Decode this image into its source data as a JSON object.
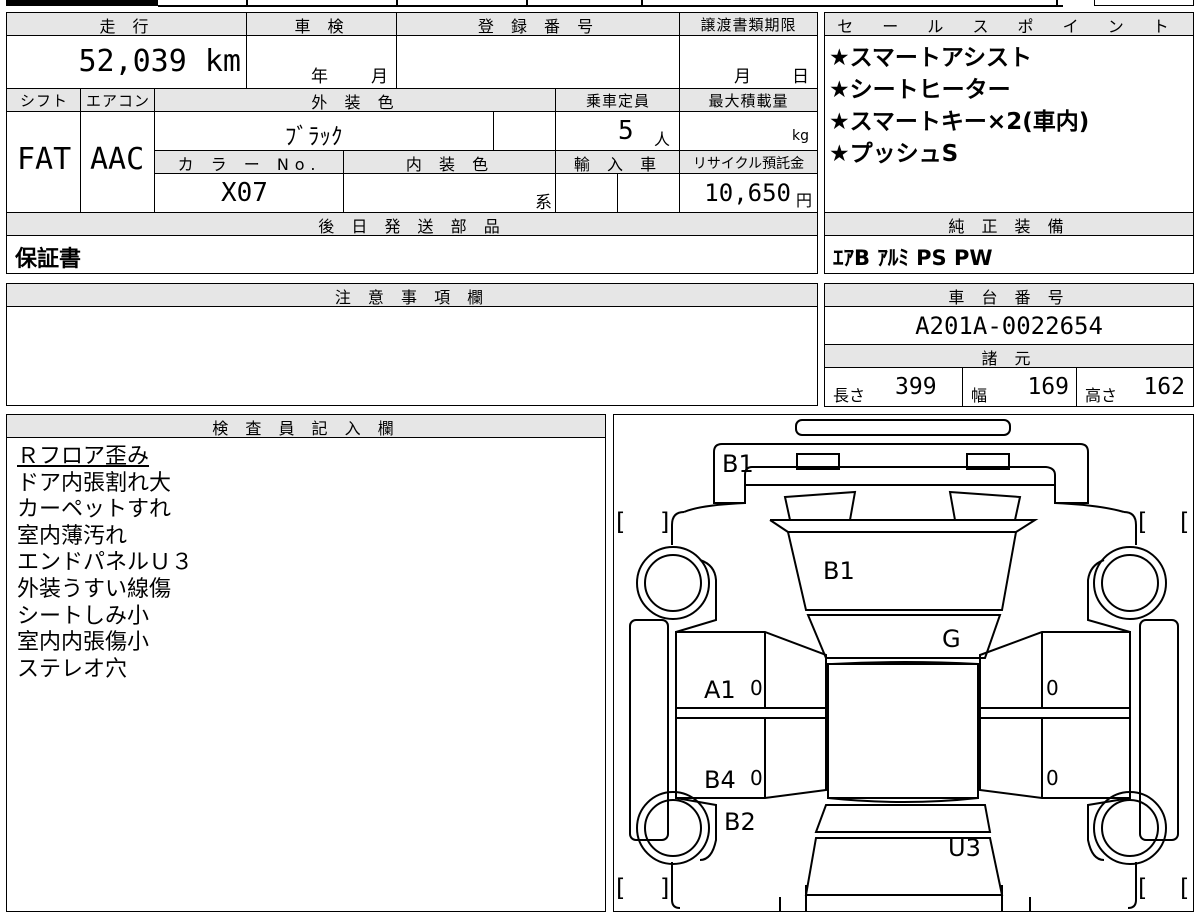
{
  "mileage": {
    "header": "走 行",
    "value": "52,039 km"
  },
  "inspection": {
    "header": "車 検",
    "year_label": "年",
    "month_label": "月"
  },
  "registration": {
    "header": "登 録 番 号",
    "value": ""
  },
  "transfer_deadline": {
    "header": "譲渡書類期限",
    "month_label": "月",
    "day_label": "日"
  },
  "shift": {
    "header": "シフト",
    "value": "FAT"
  },
  "aircon": {
    "header": "エアコン",
    "value": "AAC"
  },
  "exterior_color": {
    "header": "外 装 色",
    "value": "ﾌﾞﾗｯｸ"
  },
  "capacity": {
    "header": "乗車定員",
    "value": "5",
    "unit": "人"
  },
  "max_load": {
    "header": "最大積載量",
    "unit": "kg"
  },
  "color_no": {
    "header": "カ ラ ー No.",
    "value": "X07"
  },
  "interior_color": {
    "header": "内 装 色",
    "suffix": "系"
  },
  "import": {
    "header": "輸 入 車"
  },
  "recycle_fee": {
    "header": "リサイクル預託金",
    "value": "10,650",
    "unit": "円"
  },
  "later_parts": {
    "header": "後 日 発 送 部 品",
    "value": "保証書"
  },
  "sales_points": {
    "header": "セ ー ル ス ポ イ ン ト",
    "items": [
      "★スマートアシスト",
      "★シートヒーター",
      "★スマートキー×2(車内)",
      "★プッシュS"
    ]
  },
  "genuine_equipment": {
    "header": "純 正 装 備",
    "value": "ｴｱB ｱﾙﾐ PS PW"
  },
  "notes": {
    "header": "注 意 事 項 欄",
    "value": ""
  },
  "chassis_number": {
    "header": "車 台 番 号",
    "value": "A201A-0022654"
  },
  "specs": {
    "header": "諸 元",
    "length_label": "長さ",
    "length": "399",
    "width_label": "幅",
    "width": "169",
    "height_label": "高さ",
    "height": "162"
  },
  "inspector": {
    "header": "検 査 員 記 入 欄",
    "lines": [
      "Ｒフロア歪み",
      "ドア内張割れ大",
      "カーペットすれ",
      "室内薄汚れ",
      "エンドパネルＵ３",
      "外装うすい線傷",
      "シートしみ小",
      "室内内張傷小",
      "ステレオ穴"
    ]
  },
  "diagram": {
    "marks": {
      "b1_top": "B1",
      "b1_hood": "B1",
      "g": "G",
      "a1": "A1",
      "zero_1": "0",
      "b4": "B4",
      "zero_2": "0",
      "b2": "B2",
      "u3": "U3",
      "zero_3": "0",
      "zero_4": "0"
    },
    "bracket_left_open": "[",
    "bracket_left_close": "]",
    "bracket_right_open": "[",
    "bracket_right_close": "["
  }
}
